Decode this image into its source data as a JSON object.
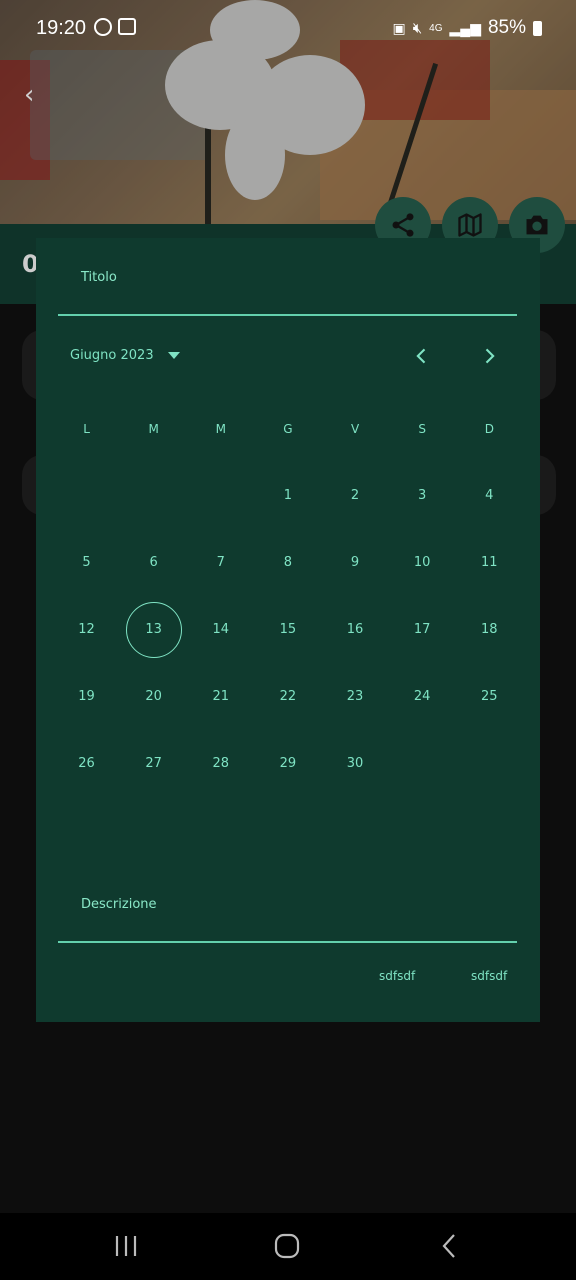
{
  "status_bar": {
    "time": "19:20",
    "network": "4G",
    "battery": "85%"
  },
  "app_bar": {
    "title_partial": "0"
  },
  "fabs": [
    "share-icon",
    "map-icon",
    "camera-icon"
  ],
  "dialog": {
    "title_label": "Titolo",
    "month_label": "Giugno 2023",
    "weekdays": [
      "L",
      "M",
      "M",
      "G",
      "V",
      "S",
      "D"
    ],
    "weeks": [
      [
        "",
        "",
        "",
        "1",
        "2",
        "3",
        "4"
      ],
      [
        "5",
        "6",
        "7",
        "8",
        "9",
        "10",
        "11"
      ],
      [
        "12",
        "13",
        "14",
        "15",
        "16",
        "17",
        "18"
      ],
      [
        "19",
        "20",
        "21",
        "22",
        "23",
        "24",
        "25"
      ],
      [
        "26",
        "27",
        "28",
        "29",
        "30",
        "",
        ""
      ]
    ],
    "selected_day": "13",
    "description_label": "Descrizione",
    "actions": [
      "sdfsdf",
      "sdfsdf"
    ]
  },
  "colors": {
    "dialog_bg": "#0f3a2e",
    "accent": "#7fe3c4"
  }
}
